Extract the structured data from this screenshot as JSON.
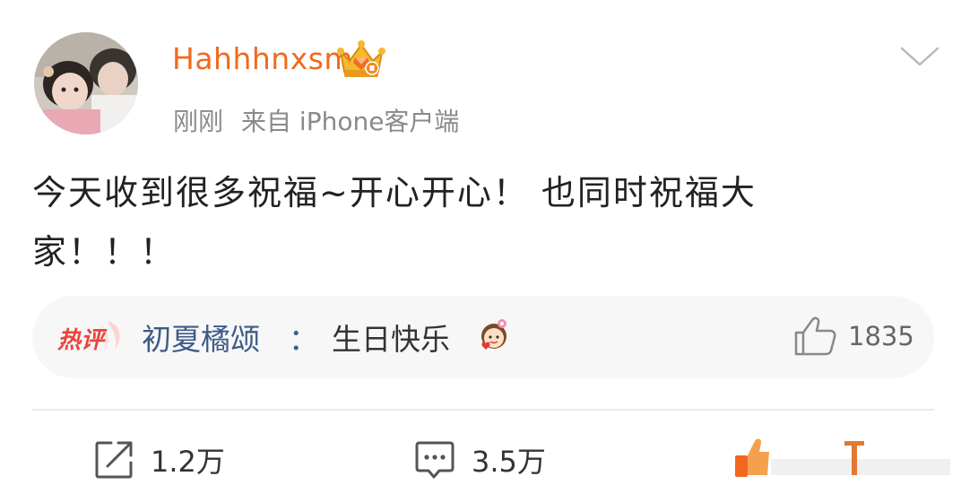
{
  "post": {
    "username": "Hahhhnxsm",
    "time": "刚刚",
    "source": "来自 iPhone客户端",
    "text_line1": "今天收到很多祝福~开心开心！ 也同时祝福大",
    "text_line2": "家！！！"
  },
  "hot_comment": {
    "badge": "热评",
    "author": "初夏橘颂",
    "colon": "：",
    "text": "生日快乐",
    "likes": "1835"
  },
  "actions": {
    "repost_count": "1.2万",
    "comment_count": "3.5万"
  },
  "colors": {
    "username": "#f06a1c",
    "comment_author": "#3d5b86",
    "hot_badge": "#e8453c"
  }
}
